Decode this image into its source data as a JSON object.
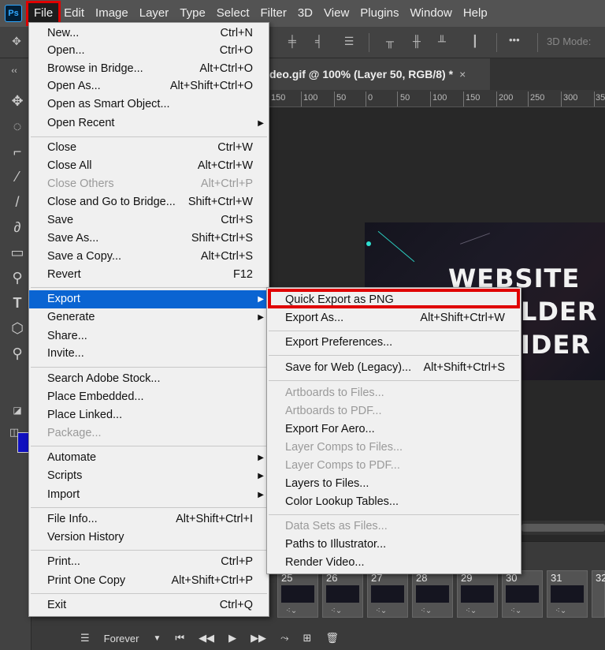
{
  "menubar": {
    "logo": "Ps",
    "items": [
      "File",
      "Edit",
      "Image",
      "Layer",
      "Type",
      "Select",
      "Filter",
      "3D",
      "View",
      "Plugins",
      "Window",
      "Help"
    ]
  },
  "options": {
    "mode_label": "3D Mode:",
    "more": "•••"
  },
  "document_tab": {
    "title": "deo.gif @ 100% (Layer 50, RGB/8) *",
    "close": "×"
  },
  "ruler": [
    "150",
    "100",
    "50",
    "0",
    "50",
    "100",
    "150",
    "200",
    "250",
    "300",
    "35"
  ],
  "image_text": [
    "WEBSITE",
    "LDER",
    "IDER"
  ],
  "file_menu": {
    "items": [
      {
        "label": "New...",
        "shortcut": "Ctrl+N"
      },
      {
        "label": "Open...",
        "shortcut": "Ctrl+O"
      },
      {
        "label": "Browse in Bridge...",
        "shortcut": "Alt+Ctrl+O"
      },
      {
        "label": "Open As...",
        "shortcut": "Alt+Shift+Ctrl+O"
      },
      {
        "label": "Open as Smart Object...",
        "shortcut": ""
      },
      {
        "label": "Open Recent",
        "shortcut": ""
      },
      {
        "label": "Close",
        "shortcut": "Ctrl+W"
      },
      {
        "label": "Close All",
        "shortcut": "Alt+Ctrl+W"
      },
      {
        "label": "Close Others",
        "shortcut": "Alt+Ctrl+P"
      },
      {
        "label": "Close and Go to Bridge...",
        "shortcut": "Shift+Ctrl+W"
      },
      {
        "label": "Save",
        "shortcut": "Ctrl+S"
      },
      {
        "label": "Save As...",
        "shortcut": "Shift+Ctrl+S"
      },
      {
        "label": "Save a Copy...",
        "shortcut": "Alt+Ctrl+S"
      },
      {
        "label": "Revert",
        "shortcut": "F12"
      },
      {
        "label": "Export",
        "shortcut": ""
      },
      {
        "label": "Generate",
        "shortcut": ""
      },
      {
        "label": "Share...",
        "shortcut": ""
      },
      {
        "label": "Invite...",
        "shortcut": ""
      },
      {
        "label": "Search Adobe Stock...",
        "shortcut": ""
      },
      {
        "label": "Place Embedded...",
        "shortcut": ""
      },
      {
        "label": "Place Linked...",
        "shortcut": ""
      },
      {
        "label": "Package...",
        "shortcut": ""
      },
      {
        "label": "Automate",
        "shortcut": ""
      },
      {
        "label": "Scripts",
        "shortcut": ""
      },
      {
        "label": "Import",
        "shortcut": ""
      },
      {
        "label": "File Info...",
        "shortcut": "Alt+Shift+Ctrl+I"
      },
      {
        "label": "Version History",
        "shortcut": ""
      },
      {
        "label": "Print...",
        "shortcut": "Ctrl+P"
      },
      {
        "label": "Print One Copy",
        "shortcut": "Alt+Shift+Ctrl+P"
      },
      {
        "label": "Exit",
        "shortcut": "Ctrl+Q"
      }
    ]
  },
  "export_menu": {
    "items": [
      {
        "label": "Quick Export as PNG",
        "shortcut": ""
      },
      {
        "label": "Export As...",
        "shortcut": "Alt+Shift+Ctrl+W"
      },
      {
        "label": "Export Preferences...",
        "shortcut": ""
      },
      {
        "label": "Save for Web (Legacy)...",
        "shortcut": "Alt+Shift+Ctrl+S"
      },
      {
        "label": "Artboards to Files...",
        "shortcut": ""
      },
      {
        "label": "Artboards to PDF...",
        "shortcut": ""
      },
      {
        "label": "Export For Aero...",
        "shortcut": ""
      },
      {
        "label": "Layer Comps to Files...",
        "shortcut": ""
      },
      {
        "label": "Layer Comps to PDF...",
        "shortcut": ""
      },
      {
        "label": "Layers to Files...",
        "shortcut": ""
      },
      {
        "label": "Color Lookup Tables...",
        "shortcut": ""
      },
      {
        "label": "Data Sets as Files...",
        "shortcut": ""
      },
      {
        "label": "Paths to Illustrator...",
        "shortcut": ""
      },
      {
        "label": "Render Video...",
        "shortcut": ""
      }
    ]
  },
  "timeline": {
    "frames": [
      "25",
      "26",
      "27",
      "28",
      "29",
      "30",
      "31",
      "32"
    ],
    "loop": "Forever"
  }
}
